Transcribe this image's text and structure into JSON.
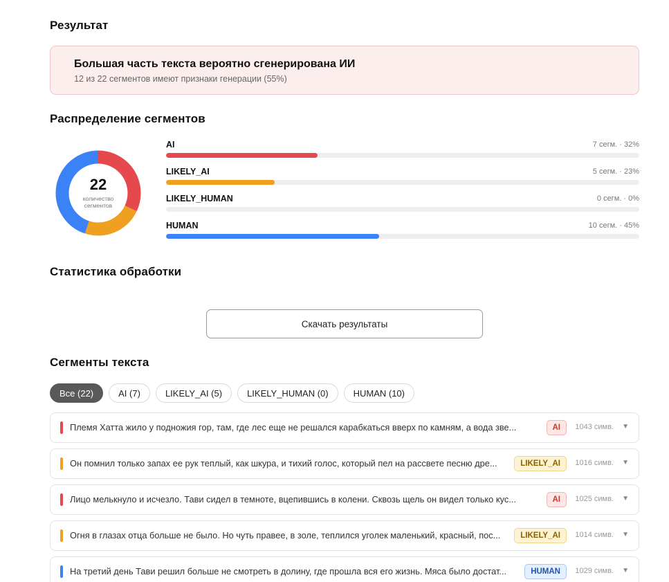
{
  "sections": {
    "result_title": "Результат",
    "distribution_title": "Распределение сегментов",
    "stats_title": "Статистика обработки",
    "segments_title": "Сегменты текста"
  },
  "result": {
    "headline": "Большая часть текста вероятно сгенерирована ИИ",
    "summary": "12 из 22 сегментов имеют признаки генерации (55%)"
  },
  "donut": {
    "total": "22",
    "caption": "количество сегментов"
  },
  "distribution": [
    {
      "label": "AI",
      "value": "7 сегм. · 32%",
      "percent": 32,
      "color": "#e5484d"
    },
    {
      "label": "LIKELY_AI",
      "value": "5 сегм. · 23%",
      "percent": 23,
      "color": "#f0a020"
    },
    {
      "label": "LIKELY_HUMAN",
      "value": "0 сегм. · 0%",
      "percent": 0,
      "color": "#9aa0a6"
    },
    {
      "label": "HUMAN",
      "value": "10 сегм. · 45%",
      "percent": 45,
      "color": "#3b82f6"
    }
  ],
  "download_label": "Скачать результаты",
  "filters": [
    {
      "label": "Все (22)",
      "active": true
    },
    {
      "label": "AI (7)",
      "active": false
    },
    {
      "label": "LIKELY_AI (5)",
      "active": false
    },
    {
      "label": "LIKELY_HUMAN (0)",
      "active": false
    },
    {
      "label": "HUMAN (10)",
      "active": false
    }
  ],
  "segments": [
    {
      "text": "Племя Хатта жило у подножия гор, там, где лес еще не решался карабкаться вверх по камням, а вода зве...",
      "label": "AI",
      "chars": "1043 симв.",
      "kind": "ai",
      "color": "#e5484d"
    },
    {
      "text": "Он помнил только запах ее рук теплый, как шкура, и тихий голос, который пел на рассвете песню дре...",
      "label": "LIKELY_AI",
      "chars": "1016 симв.",
      "kind": "likely",
      "color": "#f0a020"
    },
    {
      "text": "Лицо мелькнуло и исчезло. Тави сидел в темноте, вцепившись в колени. Сквозь щель он видел только кус...",
      "label": "AI",
      "chars": "1025 симв.",
      "kind": "ai",
      "color": "#e5484d"
    },
    {
      "text": "Огня в глазах отца больше не было. Но чуть правее, в золе, теплился уголек маленький, красный, пос...",
      "label": "LIKELY_AI",
      "chars": "1014 симв.",
      "kind": "likely",
      "color": "#f0a020"
    },
    {
      "text": "На третий день Тави решил больше не смотреть в долину, где прошла вся его жизнь. Мяса было достат...",
      "label": "HUMAN",
      "chars": "1029 симв.",
      "kind": "human",
      "color": "#3b82f6"
    }
  ]
}
